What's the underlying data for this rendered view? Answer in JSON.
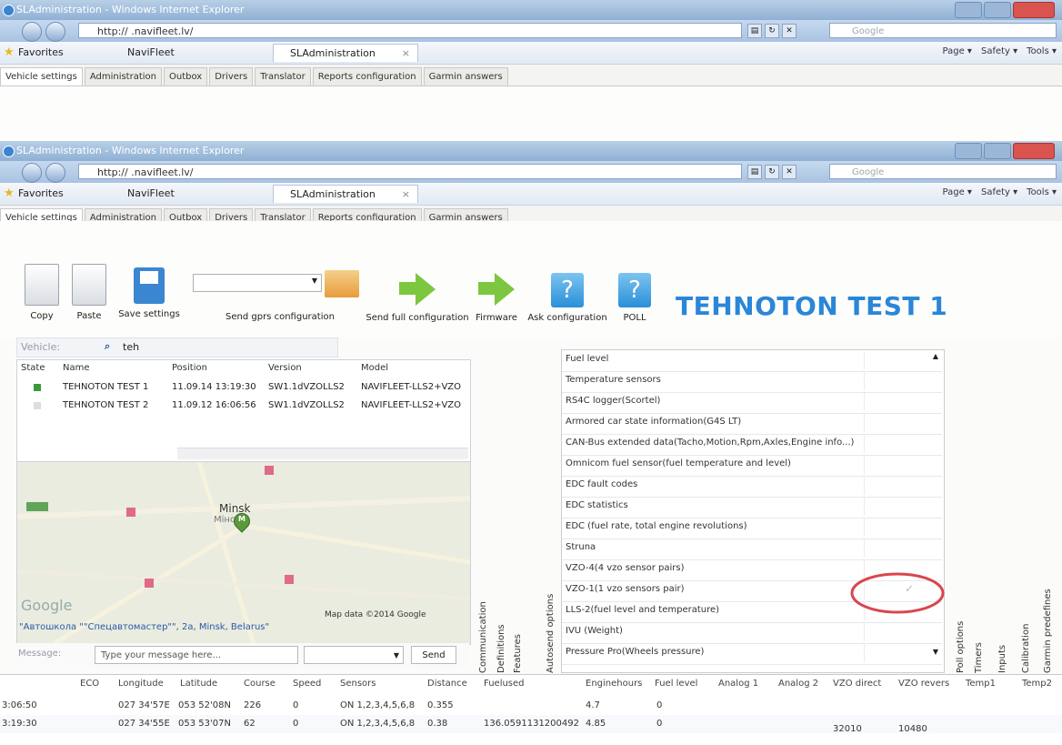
{
  "browser": {
    "window_title": "SLAdministration - Windows Internet Explorer",
    "address": "http://         .navifleet.lv/",
    "search_placeholder": "Google",
    "favorites_label": "Favorites",
    "favorite_navifleet": "NaviFleet",
    "tab_label": "SLAdministration",
    "tab_close": "×",
    "cmd_page": "Page ▾",
    "cmd_safety": "Safety ▾",
    "cmd_tools": "Tools ▾"
  },
  "app_tabs": [
    "Vehicle settings",
    "Administration",
    "Outbox",
    "Drivers",
    "Translator",
    "Reports configuration",
    "Garmin answers"
  ],
  "toolbar": {
    "copy": "Copy",
    "paste": "Paste",
    "save_settings": "Save settings",
    "send_gprs": "Send gprs configuration",
    "send_full": "Send full configuration",
    "firmware": "Firmware",
    "ask_configuration": "Ask configuration",
    "poll": "POLL",
    "vehicle_title": "TEHNOTON TEST 1"
  },
  "filter": {
    "label": "Vehicle:",
    "value": "teh"
  },
  "vehicle_grid": {
    "headers": [
      "State",
      "Name",
      "Position",
      "Version",
      "Model"
    ],
    "rows": [
      {
        "state_color": "#3a9a3a",
        "name": "TEHNOTON TEST 1",
        "position": "11.09.14 13:19:30",
        "version": "SW1.1dVZOLLS2",
        "model": "NAVIFLEET-LLS2+VZO"
      },
      {
        "state_color": "#dddddd",
        "name": "TEHNOTON TEST 2",
        "position": "11.09.12 16:06:56",
        "version": "SW1.1dVZOLLS2",
        "model": "NAVIFLEET-LLS2+VZO"
      }
    ]
  },
  "map": {
    "city": "Minsk",
    "city_local": "Мінск",
    "marker": "M",
    "logo": "Google",
    "copyright": "Map data ©2014 Google",
    "address": "\"Автошкола \"\"Спецавтомастер\"\", 2a, Minsk, Belarus\""
  },
  "message": {
    "label": "Message:",
    "placeholder": "Type your message here...",
    "send": "Send"
  },
  "side_tabs_left": [
    "Communication",
    "Definitions",
    "Features",
    "Autosend options"
  ],
  "side_tabs_right": [
    "Poll options",
    "Timers",
    "Inputs",
    "Calibration",
    "Garmin predefines"
  ],
  "options": [
    "Fuel level",
    "Temperature sensors",
    "RS4C logger(Scortel)",
    "Armored car state information(G4S LT)",
    "CAN-Bus extended data(Tacho,Motion,Rpm,Axles,Engine info...)",
    "Omnicom fuel sensor(fuel temperature and level)",
    "EDC fault codes",
    "EDC statistics",
    "EDC (fuel rate, total engine revolutions)",
    "Struna",
    "VZO-4(4 vzo sensor pairs)",
    "VZO-1(1 vzo sensors pair)",
    "LLS-2(fuel level and temperature)",
    "IVU (Weight)",
    "Pressure Pro(Wheels pressure)"
  ],
  "checked_option": "VZO-1(1 vzo sensors pair)",
  "history": {
    "headers": [
      "ECO",
      "Longitude",
      "Latitude",
      "Course",
      "Speed",
      "Sensors",
      "Distance",
      "Fuelused",
      "Enginehours",
      "Fuel level",
      "Analog 1",
      "Analog 2",
      "VZO direct",
      "VZO revers",
      "Temp1",
      "Temp2"
    ],
    "rows": [
      {
        "time": "3:06:50",
        "longitude": "027 34'57E",
        "latitude": "053 52'08N",
        "course": "226",
        "speed": "0",
        "sensors": "ON  1,2,3,4,5,6,8",
        "distance": "0.355",
        "fuelused": "",
        "enginehours": "4.7",
        "fuel_level": "0",
        "vzo_direct": "",
        "vzo_revers": ""
      },
      {
        "time": "3:19:30",
        "longitude": "027 34'55E",
        "latitude": "053 53'07N",
        "course": "62",
        "speed": "0",
        "sensors": "ON  1,2,3,4,5,6,8",
        "distance": "0.38",
        "fuelused": "136.0591131200492",
        "enginehours": "4.85",
        "fuel_level": "0",
        "vzo_direct": "32010",
        "vzo_revers": "10480"
      }
    ]
  },
  "colors": {
    "accent": "#2a86d8",
    "green_arrow": "#7cc640",
    "circle": "#d9464f"
  }
}
